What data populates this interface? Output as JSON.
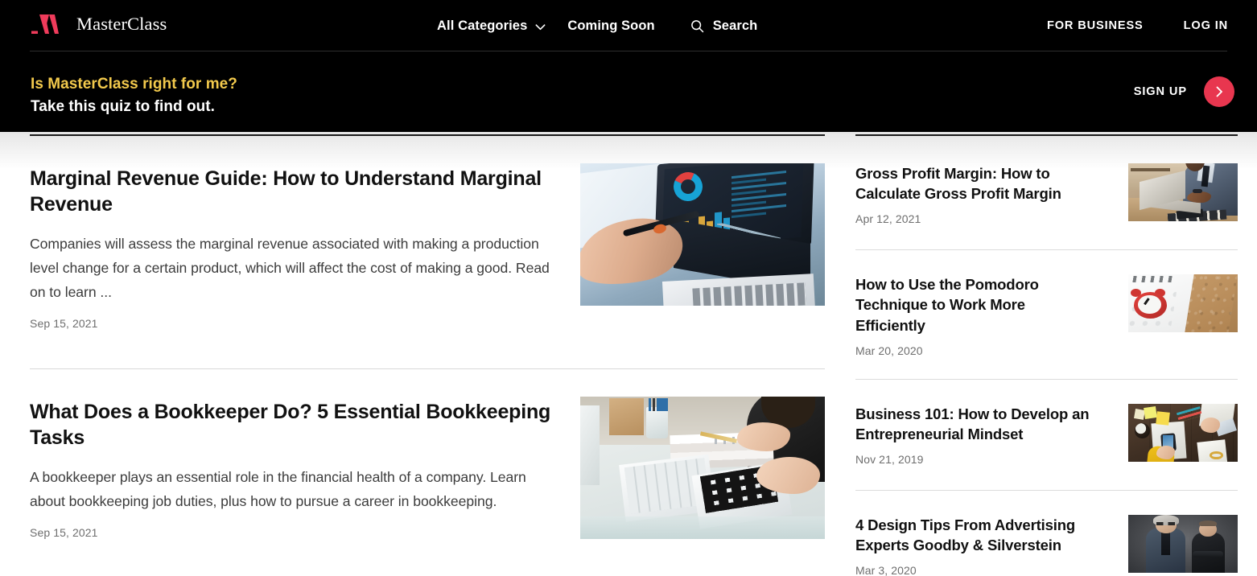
{
  "brand": {
    "logo_text": "MasterClass",
    "logo_mark_color": "#ef3b5b",
    "accent_color": "#e8364f"
  },
  "nav": {
    "categories_label": "All Categories",
    "coming_soon_label": "Coming Soon",
    "search_label": "Search",
    "for_business_label": "FOR BUSINESS",
    "log_in_label": "LOG IN"
  },
  "promo": {
    "headline": "Is MasterClass right for me?",
    "subhead": "Take this quiz to find out.",
    "cta_label": "SIGN UP",
    "headline_color": "#f2c94c"
  },
  "articles": [
    {
      "title": "Marginal Revenue Guide: How to Understand Marginal Revenue",
      "excerpt": "Companies will assess the marginal revenue associated with making a production level change for a certain product, which will affect the cost of making a good. Read on to learn ...",
      "date": "Sep 15, 2021",
      "image_alt": "hand-with-stylus-on-tablet-dashboard"
    },
    {
      "title": "What Does a Bookkeeper Do? 5 Essential Bookkeeping Tasks",
      "excerpt": "A bookkeeper plays an essential role in the financial health of a company. Learn about bookkeeping job duties, plus how to pursue a career in bookkeeping.",
      "date": "Sep 15, 2021",
      "image_alt": "bookkeeper-at-desk-with-calculator"
    }
  ],
  "sidebar": {
    "items": [
      {
        "title": "Gross Profit Margin: How to Calculate Gross Profit Margin",
        "date": "Apr 12, 2021",
        "image_alt": "businessman-working-on-laptop"
      },
      {
        "title": "How to Use the Pomodoro Technique to Work More Efficiently",
        "date": "Mar 20, 2020",
        "image_alt": "red-alarm-clock-on-calendar"
      },
      {
        "title": "Business 101: How to Develop an Entrepreneurial Mindset",
        "date": "Nov 21, 2019",
        "image_alt": "team-desk-flatlay-with-documents"
      },
      {
        "title": "4 Design Tips From Advertising Experts Goodby & Silverstein",
        "date": "Mar 3, 2020",
        "image_alt": "two-men-portrait-on-grey-background"
      }
    ]
  }
}
